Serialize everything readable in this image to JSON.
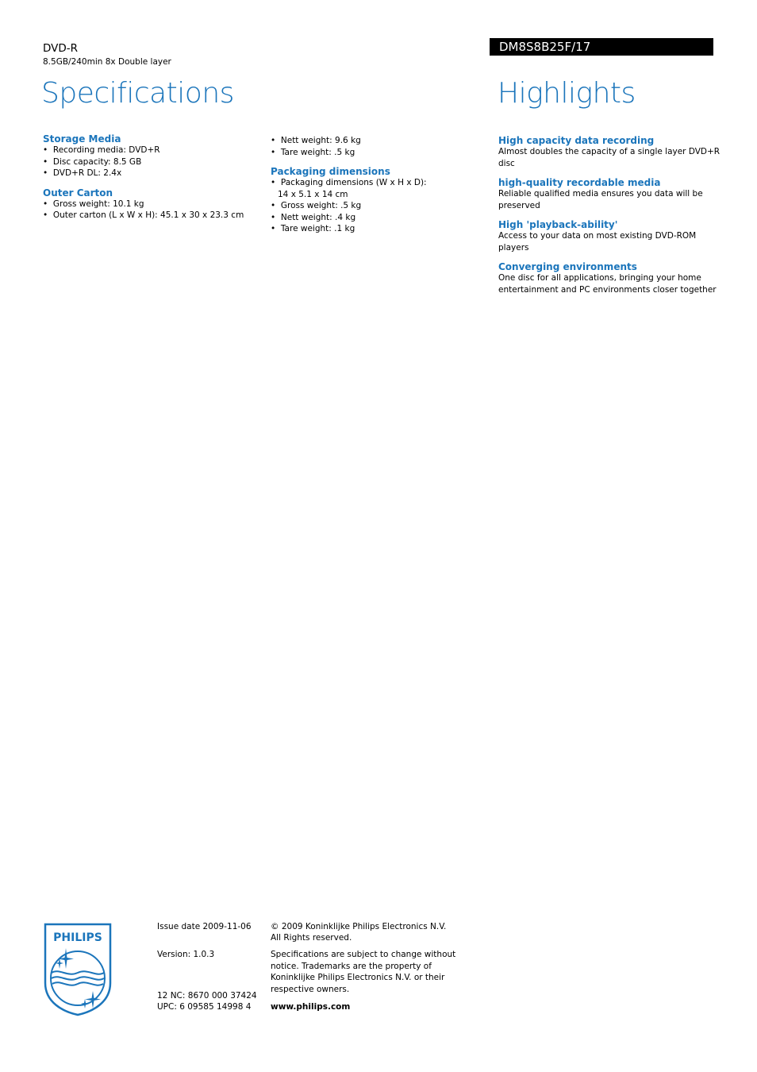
{
  "header": {
    "product_type": "DVD-R",
    "product_description": "8.5GB/240min 8x Double layer",
    "model_number": "DM8S8B25F/17",
    "specifications_title": "Specifications",
    "highlights_title": "Highlights"
  },
  "specifications": {
    "column1": [
      {
        "heading": "Storage Media",
        "items": [
          "Recording media: DVD+R",
          "Disc capacity: 8.5 GB",
          "DVD+R DL: 2.4x"
        ]
      },
      {
        "heading": "Outer Carton",
        "items": [
          "Gross weight: 10.1 kg",
          "Outer carton (L x W x H): 45.1 x 30 x 23.3 cm"
        ]
      }
    ],
    "column2_continued": [
      "Nett weight: 9.6 kg",
      "Tare weight: .5 kg"
    ],
    "column2": [
      {
        "heading": "Packaging dimensions",
        "items": [
          "Packaging dimensions (W x H x D): 14 x 5.1 x 14 cm",
          "Gross weight: .5 kg",
          "Nett weight: .4 kg",
          "Tare weight: .1 kg"
        ]
      }
    ]
  },
  "highlights": [
    {
      "heading": "High capacity data recording",
      "body": "Almost doubles the capacity of a single layer DVD+R disc"
    },
    {
      "heading": "high-quality recordable media",
      "body": "Reliable qualified media ensures you data will be preserved"
    },
    {
      "heading": "High 'playback-ability'",
      "body": "Access to your data on most existing DVD-ROM players"
    },
    {
      "heading": "Converging environments",
      "body": "One disc for all applications, bringing your home entertainment and PC environments closer together"
    }
  ],
  "footer": {
    "logo_text": "PHILIPS",
    "logo_icon": "philips-shield-icon",
    "issue_date": "Issue date 2009-11-06",
    "version": "Version: 1.0.3",
    "nc": "12 NC: 8670 000 37424",
    "upc": "UPC: 6 09585 14998 4",
    "copyright_line1": "© 2009 Koninklijke Philips Electronics N.V.",
    "copyright_line2": "All Rights reserved.",
    "disclaimer": "Specifications are subject to change without notice. Trademarks are the property of Koninklijke Philips Electronics N.V. or their respective owners.",
    "website": "www.philips.com"
  },
  "colors": {
    "accent": "#1b75bb",
    "model_bar": "#000000"
  }
}
